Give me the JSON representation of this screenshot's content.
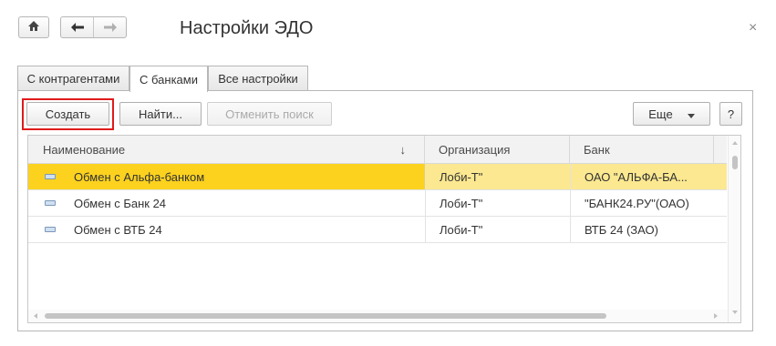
{
  "window": {
    "title": "Настройки ЭДО",
    "close_icon": "close-icon",
    "home_icon": "home-icon",
    "back_icon": "arrow-left-icon",
    "forward_icon": "arrow-right-icon"
  },
  "tabs": [
    {
      "label": "С контрагентами",
      "active": false
    },
    {
      "label": "С банками",
      "active": true
    },
    {
      "label": "Все настройки",
      "active": false
    }
  ],
  "toolbar": {
    "create_label": "Создать",
    "find_label": "Найти...",
    "cancel_search_label": "Отменить поиск",
    "more_label": "Еще",
    "help_label": "?"
  },
  "table": {
    "columns": [
      "Наименование",
      "Организация",
      "Банк"
    ],
    "sort_indicator": "↓",
    "rows": [
      {
        "name": "Обмен с Альфа-банком",
        "org": "Лоби-Т\"",
        "bank": "ОАО \"АЛЬФА-БА...",
        "selected": true
      },
      {
        "name": "Обмен с Банк 24",
        "org": "Лоби-Т\"",
        "bank": "\"БАНК24.РУ\"(ОАО)",
        "selected": false
      },
      {
        "name": "Обмен с ВТБ 24",
        "org": "Лоби-Т\"",
        "bank": "ВТБ 24 (ЗАО)",
        "selected": false
      }
    ]
  },
  "colors": {
    "selected_row_primary": "#fcd21f",
    "selected_row_secondary": "#fbe890",
    "highlight_border": "#e01b1b"
  }
}
